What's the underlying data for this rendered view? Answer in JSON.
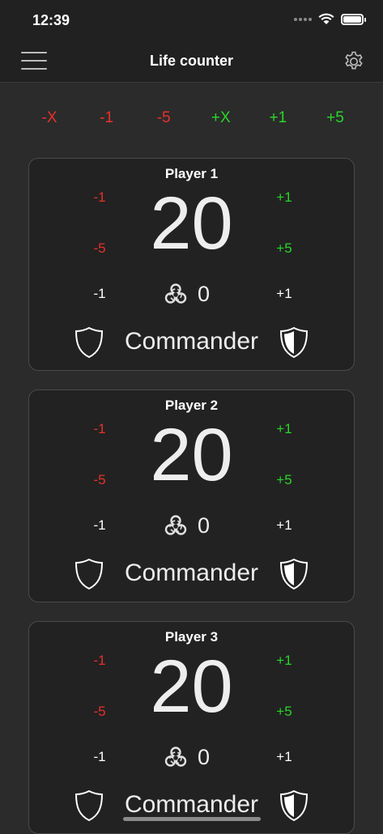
{
  "status": {
    "time": "12:39"
  },
  "nav": {
    "title": "Life counter"
  },
  "quick_buttons": [
    {
      "label": "-X",
      "color": "#e8302a"
    },
    {
      "label": "-1",
      "color": "#e8302a"
    },
    {
      "label": "-5",
      "color": "#e8302a"
    },
    {
      "label": "+X",
      "color": "#28d628"
    },
    {
      "label": "+1",
      "color": "#28d628"
    },
    {
      "label": "+5",
      "color": "#28d628"
    }
  ],
  "players": [
    {
      "name": "Player 1",
      "life": "20",
      "life_minus_1": "-1",
      "life_minus_5": "-5",
      "life_plus_1": "+1",
      "life_plus_5": "+5",
      "poison_minus": "-1",
      "poison_value": "0",
      "poison_plus": "+1",
      "commander_label": "Commander"
    },
    {
      "name": "Player 2",
      "life": "20",
      "life_minus_1": "-1",
      "life_minus_5": "-5",
      "life_plus_1": "+1",
      "life_plus_5": "+5",
      "poison_minus": "-1",
      "poison_value": "0",
      "poison_plus": "+1",
      "commander_label": "Commander"
    },
    {
      "name": "Player 3",
      "life": "20",
      "life_minus_1": "-1",
      "life_minus_5": "-5",
      "life_plus_1": "+1",
      "life_plus_5": "+5",
      "poison_minus": "-1",
      "poison_value": "0",
      "poison_plus": "+1",
      "commander_label": "Commander"
    }
  ],
  "colors": {
    "negative": "#e8302a",
    "positive": "#28d628",
    "background": "#2b2b2b",
    "card": "#222222"
  }
}
